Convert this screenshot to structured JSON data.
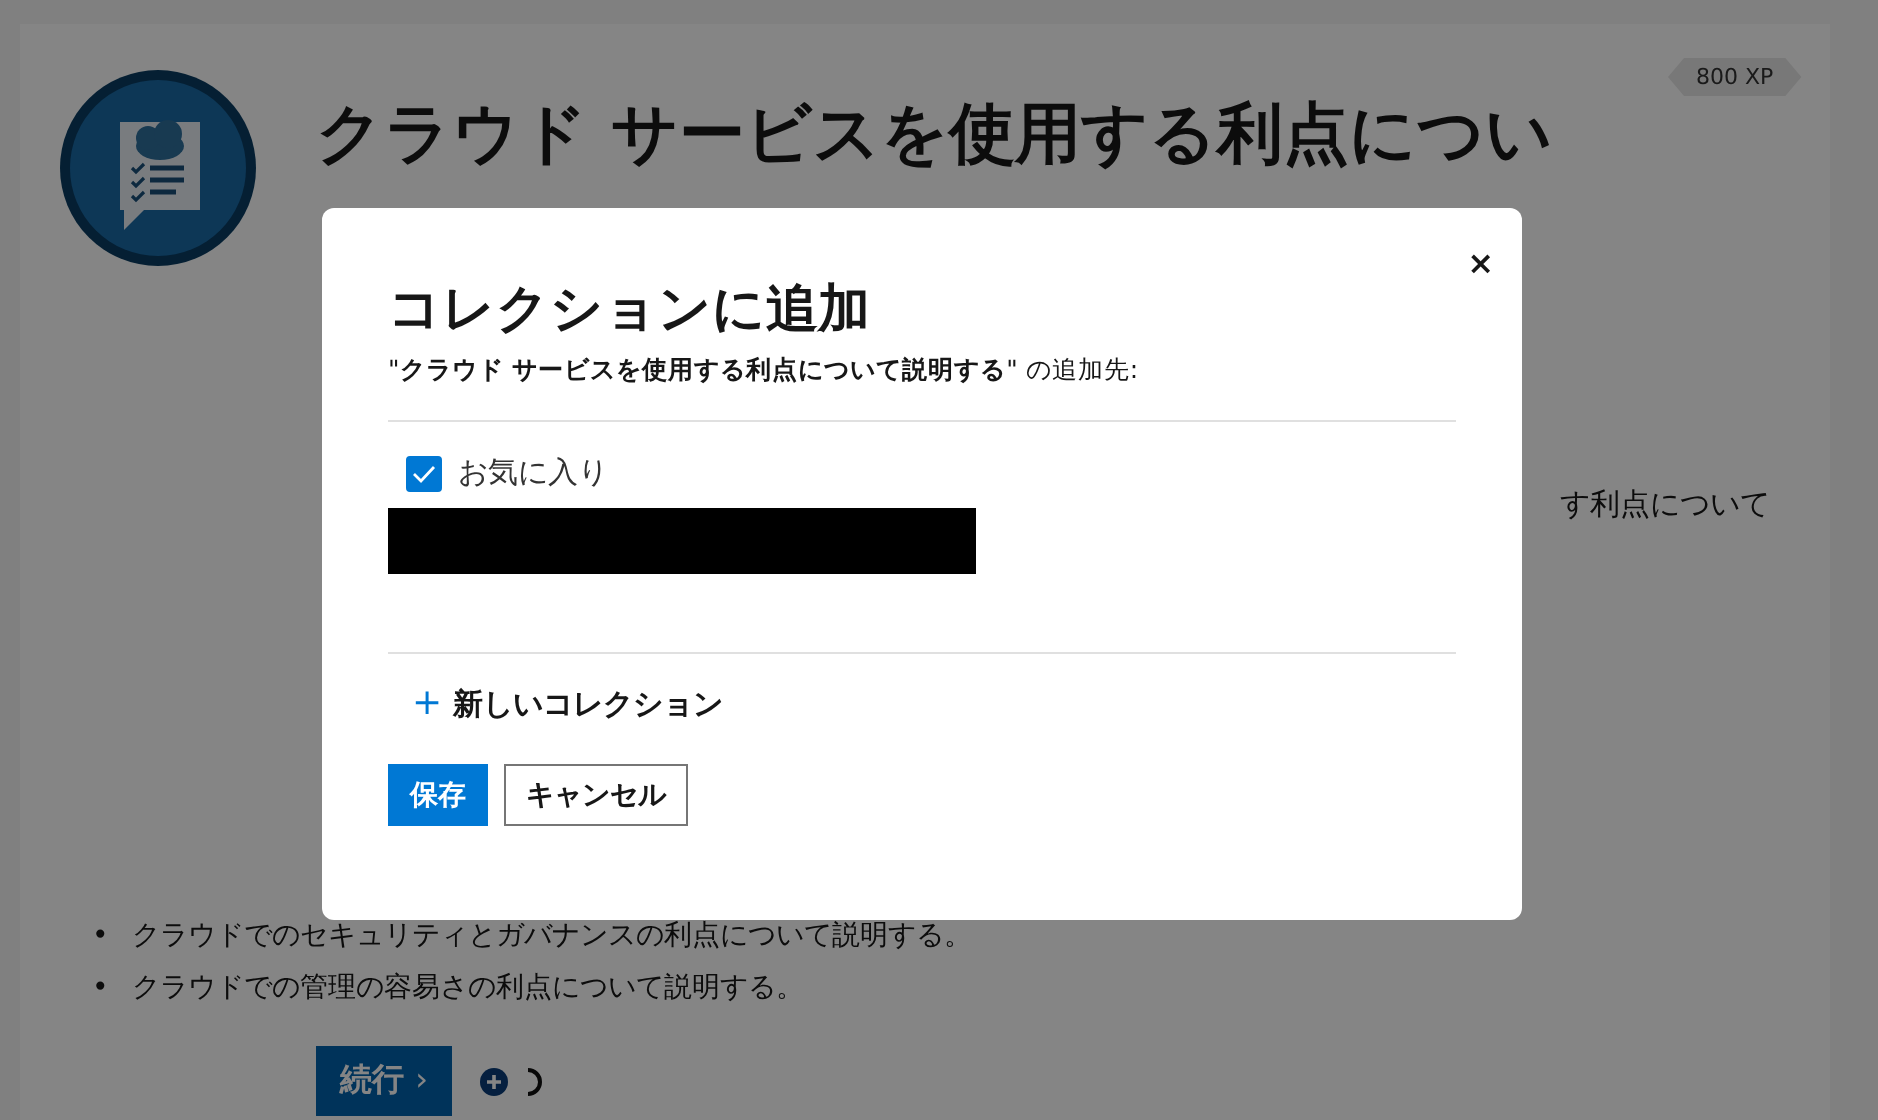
{
  "page": {
    "xp_badge": "800 XP",
    "title": "クラウド サービスを使用する利点につい",
    "bullet": "•",
    "paragraph_fragment": "す利点について",
    "objectives": [
      "クラウドでのセキュリティとガバナンスの利点について説明する。",
      "クラウドでの管理の容易さの利点について説明する。"
    ],
    "continue_button": "続行",
    "continue_chevron": "›"
  },
  "dialog": {
    "title": "コレクションに追加",
    "subtitle": "\"**クラウド サービスを使用する利点について説明する**\" の追加先:",
    "close": "×",
    "collections": [
      {
        "label": "お気に入り",
        "checked": true
      },
      {
        "kind": "redacted"
      }
    ],
    "new_collection": "新しいコレクション",
    "new_collection_icon": "+",
    "buttons": [
      {
        "label": "保存",
        "kind": "primary"
      },
      {
        "label": "キャンセル",
        "kind": "secondary"
      }
    ]
  }
}
